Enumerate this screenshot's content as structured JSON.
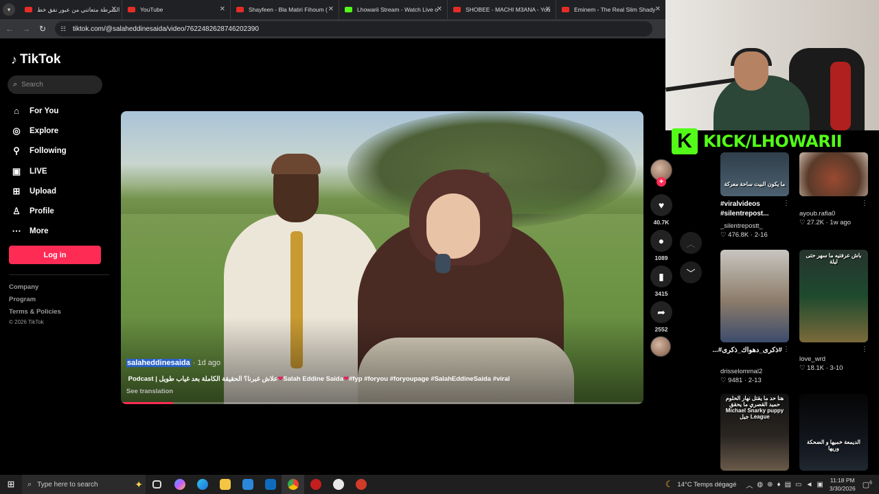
{
  "browser": {
    "tabs": [
      {
        "title": "الشرطة متعاتني من عبور نفق خط",
        "kind": "yt"
      },
      {
        "title": "YouTube",
        "kind": "yt"
      },
      {
        "title": "Shayfeen - Bla Matiri Fihoum (",
        "kind": "yt"
      },
      {
        "title": "Lhowarii Stream - Watch Live o",
        "kind": "kick"
      },
      {
        "title": "SHOBEE - MACHI M3ANA - You",
        "kind": "yt"
      },
      {
        "title": "Eminem - The Real Slim Shady",
        "kind": "yt"
      }
    ],
    "url": "tiktok.com/@salaheddinesaida/video/7622482628746202390"
  },
  "sidebar": {
    "logo": "TikTok",
    "search_placeholder": "Search",
    "items": [
      {
        "label": "For You",
        "icon": "home-icon"
      },
      {
        "label": "Explore",
        "icon": "compass-icon"
      },
      {
        "label": "Following",
        "icon": "following-icon"
      },
      {
        "label": "LIVE",
        "icon": "live-icon"
      },
      {
        "label": "Upload",
        "icon": "upload-icon"
      },
      {
        "label": "Profile",
        "icon": "profile-icon"
      },
      {
        "label": "More",
        "icon": "more-icon"
      }
    ],
    "login_label": "Log in",
    "footer": [
      "Company",
      "Program",
      "Terms & Policies"
    ],
    "copyright": "© 2026 TikTok"
  },
  "video": {
    "author": "salaheddinesaida",
    "age": " · 1d ago",
    "caption_text": "علاش غبرنا؟ الحقيقة الكاملة بعد غياب طويل | Podcast ",
    "caption_name": "Salah Eddine Saida",
    "caption_tags": "#fyp #foryou #foryoupage #SalahEddineSaida #viral",
    "see_translation": "See translation",
    "progress": 0.1
  },
  "actions": {
    "likes": "40.7K",
    "comments": "1089",
    "saves": "3415",
    "shares": "2552"
  },
  "overlay": {
    "kick_text": "KICK/LHOWARII"
  },
  "suggested": [
    {
      "thumb_text": "ما يكون البيت ساحة معركة",
      "title": "#viralvideos #silentrepost...",
      "user": "_silentrepostt_",
      "stats": "♡ 476.8K · 2-16"
    },
    {
      "thumb_text": "",
      "title": "",
      "user": "ayoub.rafia0",
      "stats": "♡ 27.2K · 1w ago"
    },
    {
      "thumb_text": "",
      "title": "#ذكرى_دهواك_ذكرى#...",
      "user": "drisselommal2",
      "stats": "♡ 9481 · 2-13"
    },
    {
      "thumb_text": "باش عرفتيه ما سهر حتى ليلة",
      "title": "",
      "user": "love_wrd",
      "stats": "♡ 18.1K · 3-10"
    },
    {
      "thumb_text": "هنا حد ما يقتل نهار الحلوم حميد القصري ما يحقق Michael Snarky puppy جيل League",
      "title": "",
      "user": "",
      "stats": ""
    },
    {
      "thumb_text": "الديمعة خميها و الضحكة وريها",
      "title": "",
      "user": "",
      "stats": ""
    }
  ],
  "taskbar": {
    "search_placeholder": "Type here to search",
    "weather": "14°C  Temps dégagé",
    "time": "11:18 PM",
    "date": "3/30/2026",
    "notifications": "6"
  }
}
